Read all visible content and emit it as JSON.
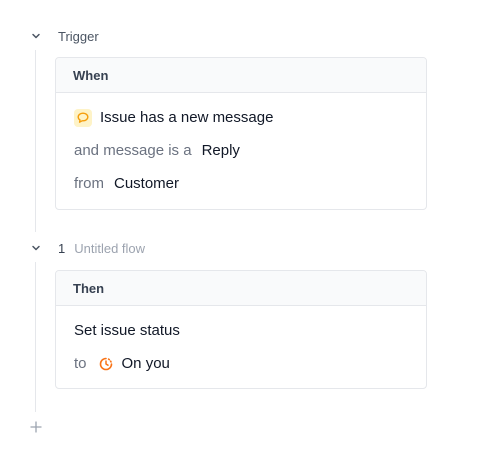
{
  "trigger": {
    "title": "Trigger",
    "card_header": "When",
    "event": "Issue has a new message",
    "condition_label": "and message is a",
    "condition_value": "Reply",
    "from_label": "from",
    "from_value": "Customer"
  },
  "flow": {
    "number": "1",
    "name": "Untitled flow",
    "card_header": "Then",
    "action": "Set issue status",
    "to_label": "to",
    "to_value": "On you"
  },
  "colors": {
    "message_icon": "#f59e0b",
    "status_icon": "#f97316",
    "line": "#e5e7eb"
  }
}
